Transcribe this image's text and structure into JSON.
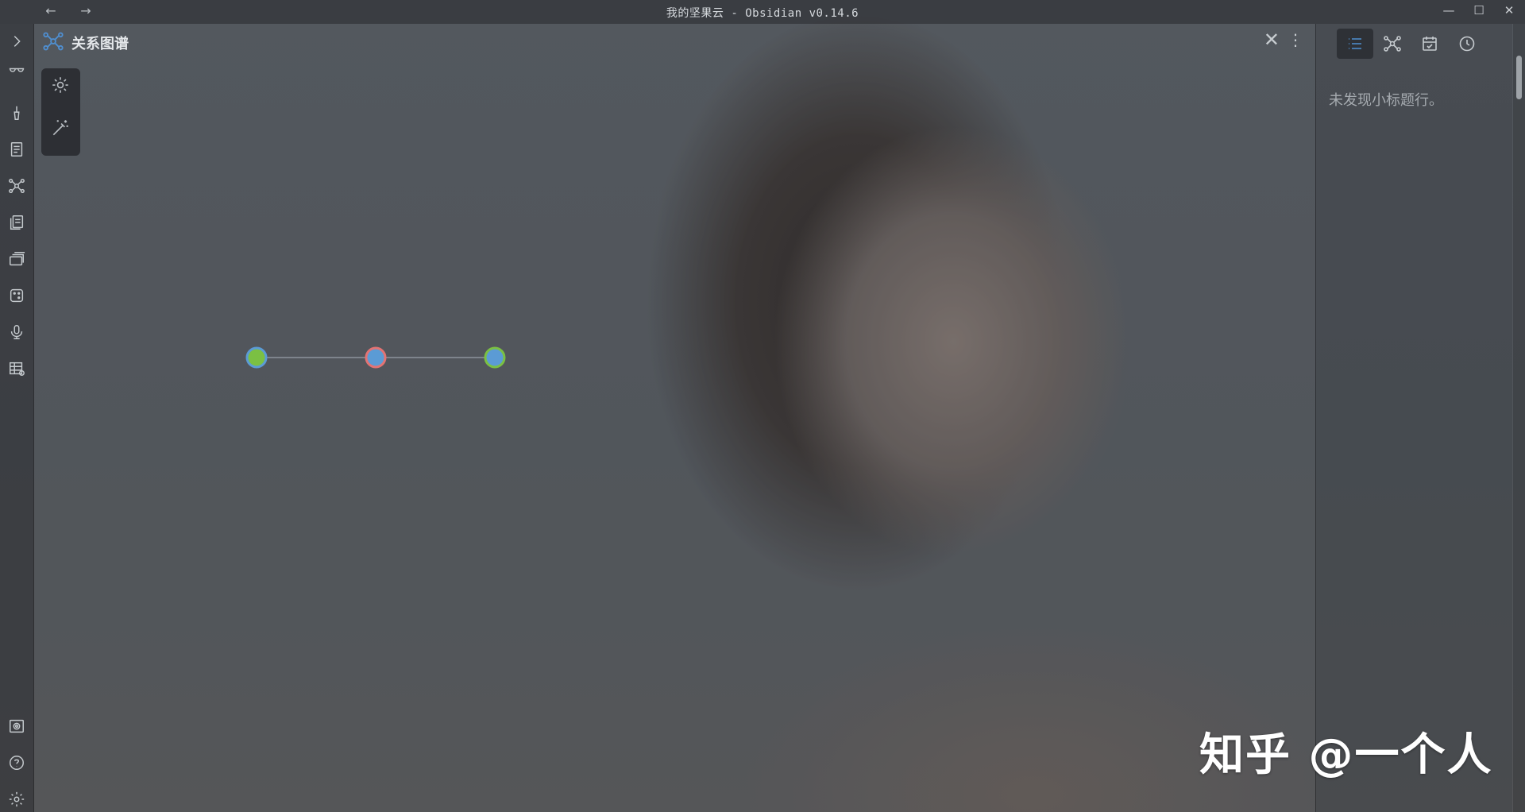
{
  "window": {
    "title": "我的坚果云 - Obsidian v0.14.6",
    "back": "←",
    "forward": "→",
    "minimize": "—",
    "maximize": "☐",
    "close": "✕"
  },
  "ribbon": {
    "top": [
      "chevron-right-icon",
      "glasses-icon",
      "brush-icon",
      "file-list-icon",
      "graph-icon",
      "files-icon",
      "cards-icon",
      "dice-icon",
      "microphone-icon",
      "table-icon"
    ],
    "bottom": [
      "vault-icon",
      "help-icon",
      "settings-icon"
    ]
  },
  "tab": {
    "title": "关系图谱",
    "close": "✕",
    "more": "⋮"
  },
  "graph_controls": [
    "gear-icon",
    "magic-wand-icon"
  ],
  "graph": {
    "colors": {
      "default": "#5b9bd5",
      "attachment": "#7bc043",
      "tag": "#e37373"
    },
    "clusters": [
      {
        "kind": "default",
        "hubColor": "attachment",
        "leafColor": "default"
      },
      {
        "kind": "tag",
        "hubColor": "default",
        "leafColor": "tag"
      },
      {
        "kind": "attachment",
        "hubColor": "default",
        "leafColor": "attachment"
      }
    ]
  },
  "right_sidebar": {
    "tabs": [
      "outline-icon",
      "graph-icon",
      "calendar-icon",
      "clock-icon"
    ],
    "outline_empty": "未发现小标题行。"
  },
  "watermark": "知乎 @一个人"
}
